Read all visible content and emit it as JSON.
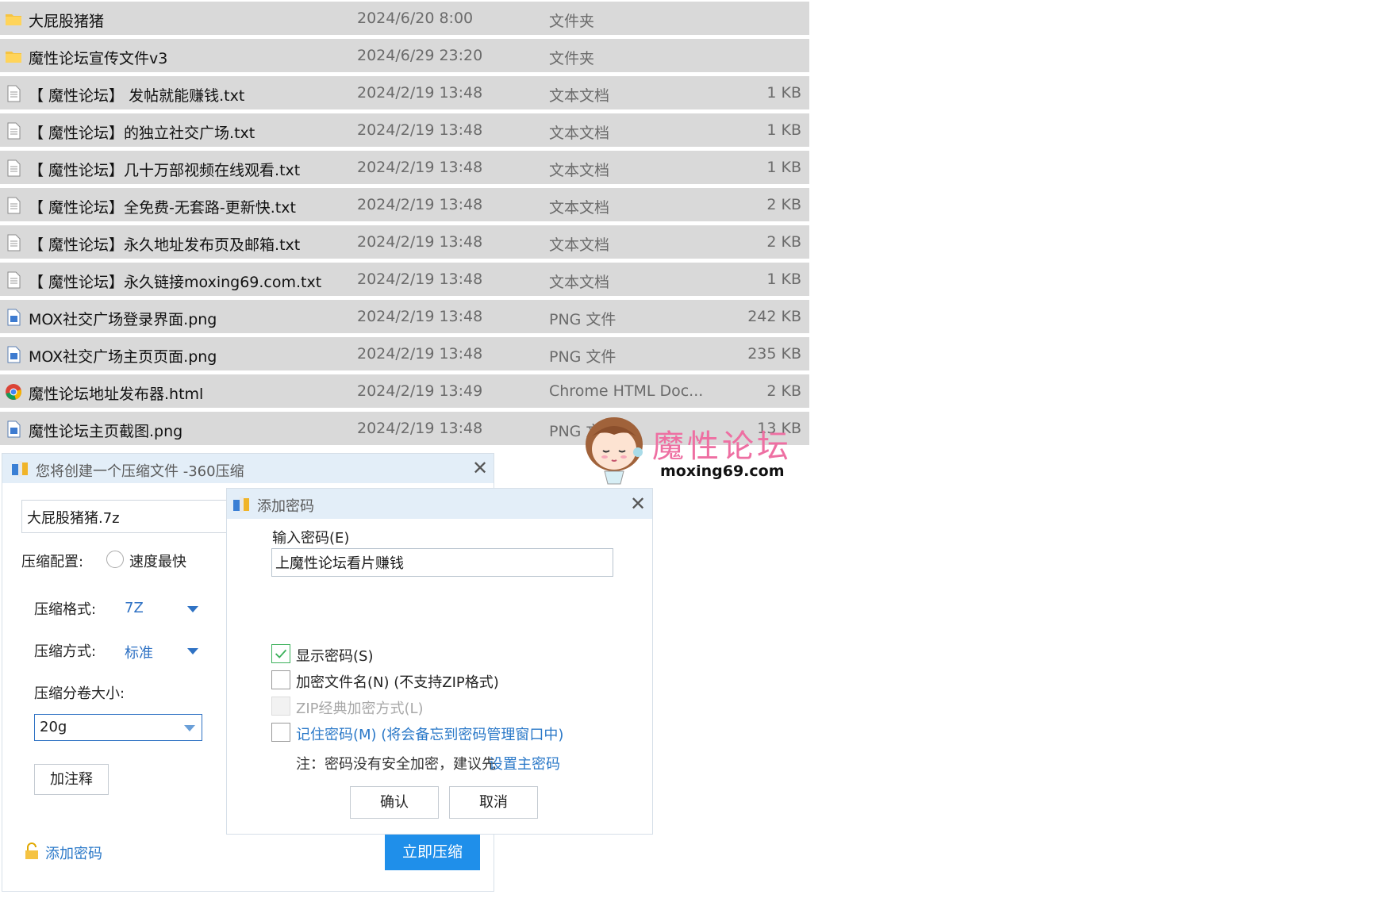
{
  "files": [
    {
      "name": "大屁股猪猪",
      "date": "2024/6/20 8:00",
      "type": "文件夹",
      "size": "",
      "icon": "folder-icon"
    },
    {
      "name": "魔性论坛宣传文件v3",
      "date": "2024/6/29 23:20",
      "type": "文件夹",
      "size": "",
      "icon": "folder-icon"
    },
    {
      "name": "【 魔性论坛】 发帖就能赚钱.txt",
      "date": "2024/2/19 13:48",
      "type": "文本文档",
      "size": "1 KB",
      "icon": "text-file-icon"
    },
    {
      "name": "【 魔性论坛】的独立社交广场.txt",
      "date": "2024/2/19 13:48",
      "type": "文本文档",
      "size": "1 KB",
      "icon": "text-file-icon"
    },
    {
      "name": "【 魔性论坛】几十万部视频在线观看.txt",
      "date": "2024/2/19 13:48",
      "type": "文本文档",
      "size": "1 KB",
      "icon": "text-file-icon"
    },
    {
      "name": "【 魔性论坛】全免费-无套路-更新快.txt",
      "date": "2024/2/19 13:48",
      "type": "文本文档",
      "size": "2 KB",
      "icon": "text-file-icon"
    },
    {
      "name": "【 魔性论坛】永久地址发布页及邮箱.txt",
      "date": "2024/2/19 13:48",
      "type": "文本文档",
      "size": "2 KB",
      "icon": "text-file-icon"
    },
    {
      "name": "【 魔性论坛】永久链接moxing69.com.txt",
      "date": "2024/2/19 13:48",
      "type": "文本文档",
      "size": "1 KB",
      "icon": "text-file-icon"
    },
    {
      "name": "MOX社交广场登录界面.png",
      "date": "2024/2/19 13:48",
      "type": "PNG 文件",
      "size": "242 KB",
      "icon": "image-file-icon"
    },
    {
      "name": "MOX社交广场主页页面.png",
      "date": "2024/2/19 13:48",
      "type": "PNG 文件",
      "size": "235 KB",
      "icon": "image-file-icon"
    },
    {
      "name": "魔性论坛地址发布器.html",
      "date": "2024/2/19 13:49",
      "type": "Chrome HTML Doc...",
      "size": "2 KB",
      "icon": "chrome-icon"
    },
    {
      "name": "魔性论坛主页截图.png",
      "date": "2024/2/19 13:48",
      "type": "PNG 文件",
      "size": "13 KB",
      "icon": "image-file-icon"
    }
  ],
  "watermark": {
    "title": "魔性论坛",
    "url": "moxing69.com"
  },
  "main_dialog": {
    "title": "您将创建一个压缩文件 -360压缩",
    "archive_name": "大屁股猪猪.7z",
    "config_label": "压缩配置:",
    "speed_option": "速度最快",
    "format_label": "压缩格式:",
    "format_value": "7Z",
    "method_label": "压缩方式:",
    "method_value": "标准",
    "volume_label": "压缩分卷大小:",
    "volume_value": "20g",
    "comment_button": "加注释",
    "add_password_link": "添加密码",
    "compress_button": "立即压缩"
  },
  "password_dialog": {
    "title": "添加密码",
    "input_label": "输入密码(E)",
    "password_value": "上魔性论坛看片赚钱",
    "show_password": {
      "label": "显示密码(S)",
      "checked": true
    },
    "encrypt_filenames": {
      "label": "加密文件名(N) (不支持ZIP格式)",
      "checked": false
    },
    "zip_classic": {
      "label": "ZIP经典加密方式(L)",
      "checked": false,
      "disabled": true
    },
    "remember_password": {
      "label": "记住密码(M) (将会备忘到密码管理窗口中)",
      "checked": false
    },
    "note_prefix": "注：密码没有安全加密，建议先",
    "note_link": "设置主密码",
    "ok_button": "确认",
    "cancel_button": "取消"
  },
  "colors": {
    "accent_blue": "#1f8fea",
    "link_blue": "#2a78c8",
    "row_bg": "#d9d9d9",
    "titlebar_bg": "#e3eef8",
    "check_green": "#3cb15b",
    "watermark_pink": "#ee6fa2"
  }
}
